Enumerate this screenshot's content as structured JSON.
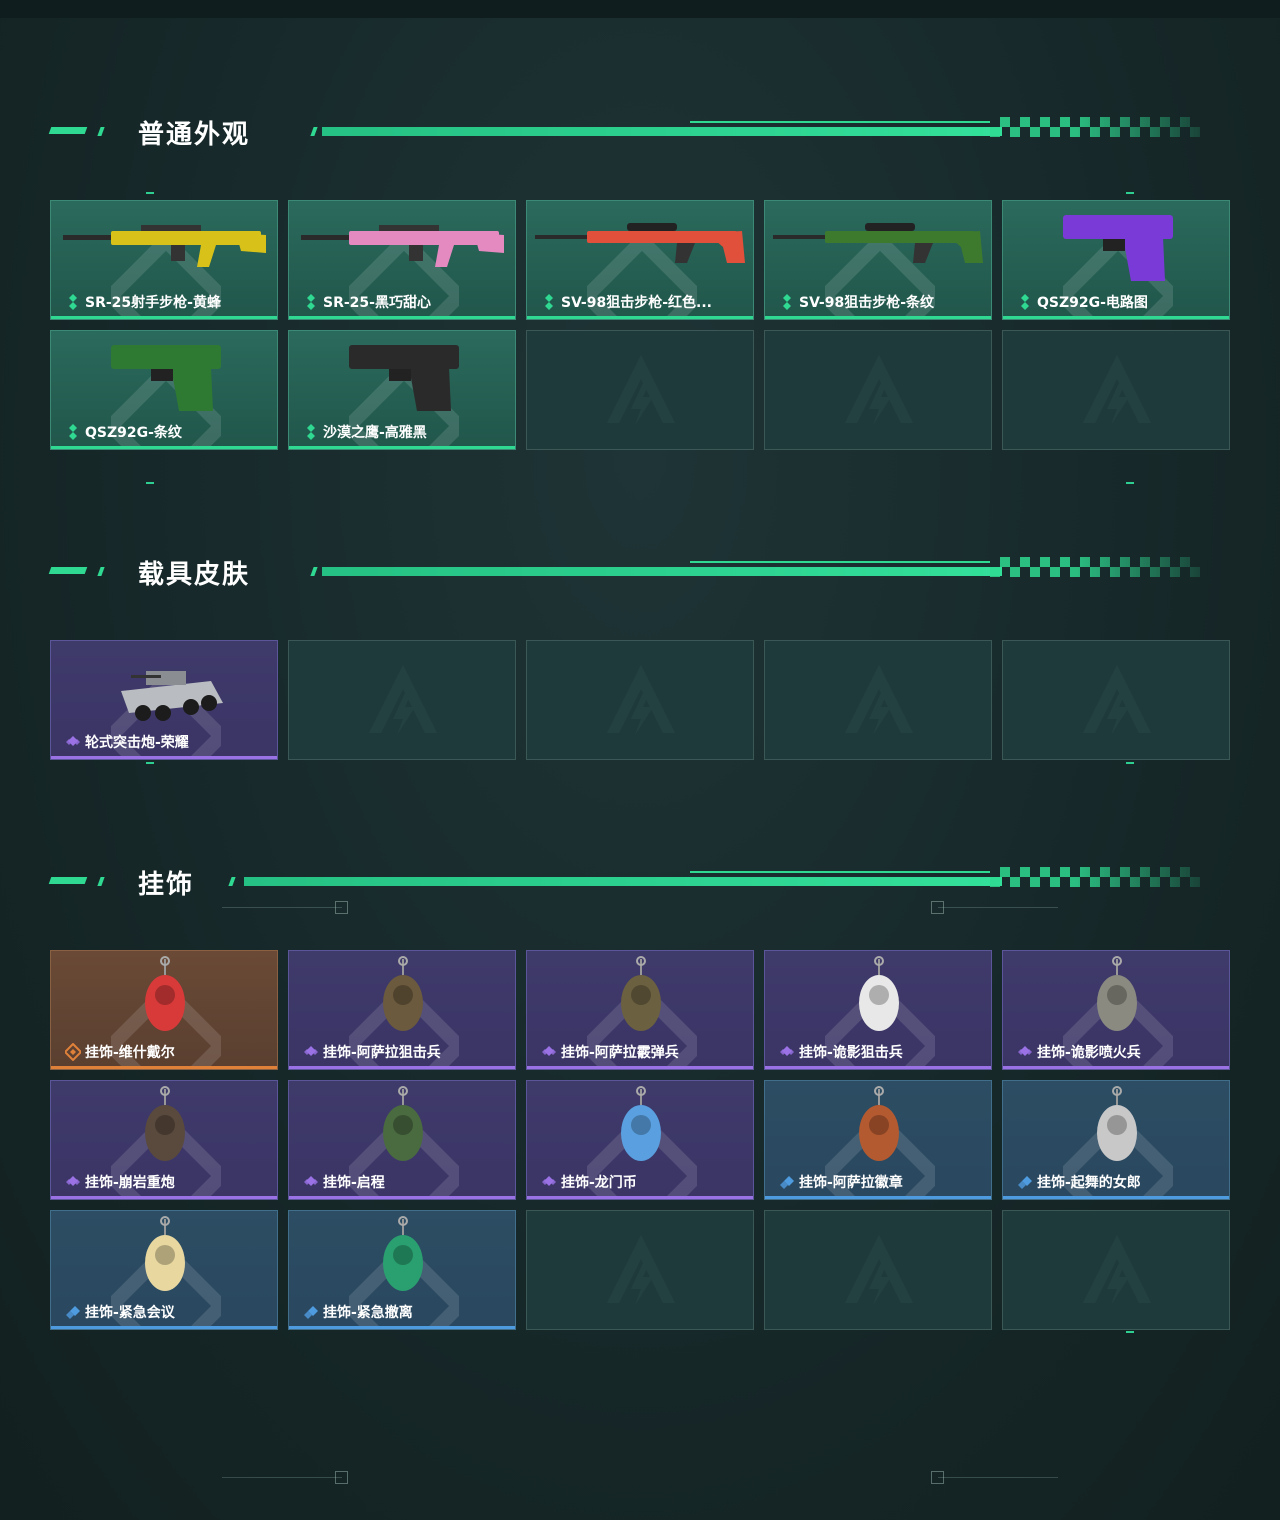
{
  "sections": [
    {
      "title": "普通外观",
      "items": [
        {
          "label": "SR-25射手步枪-黄蜂",
          "rarity": "green",
          "icon": "rifle-icon"
        },
        {
          "label": "SR-25-黑巧甜心",
          "rarity": "green",
          "icon": "rifle-icon"
        },
        {
          "label": "SV-98狙击步枪-红色...",
          "rarity": "green",
          "icon": "sniper-rifle-icon"
        },
        {
          "label": "SV-98狙击步枪-条纹",
          "rarity": "green",
          "icon": "sniper-rifle-icon"
        },
        {
          "label": "QSZ92G-电路图",
          "rarity": "green",
          "icon": "pistol-icon"
        },
        {
          "label": "QSZ92G-条纹",
          "rarity": "green",
          "icon": "pistol-icon"
        },
        {
          "label": "沙漠之鹰-高雅黑",
          "rarity": "green",
          "icon": "pistol-icon"
        }
      ],
      "empty_slots": 3
    },
    {
      "title": "载具皮肤",
      "items": [
        {
          "label": "轮式突击炮-荣耀",
          "rarity": "purple",
          "icon": "armored-vehicle-icon"
        }
      ],
      "empty_slots": 4
    },
    {
      "title": "挂饰",
      "items": [
        {
          "label": "挂饰-维什戴尔",
          "rarity": "orange",
          "icon": "charm-icon"
        },
        {
          "label": "挂饰-阿萨拉狙击兵",
          "rarity": "purple",
          "icon": "charm-icon"
        },
        {
          "label": "挂饰-阿萨拉霰弹兵",
          "rarity": "purple",
          "icon": "charm-icon"
        },
        {
          "label": "挂饰-诡影狙击兵",
          "rarity": "purple",
          "icon": "charm-icon"
        },
        {
          "label": "挂饰-诡影喷火兵",
          "rarity": "purple",
          "icon": "charm-icon"
        },
        {
          "label": "挂饰-崩岩重炮",
          "rarity": "purple",
          "icon": "charm-icon"
        },
        {
          "label": "挂饰-启程",
          "rarity": "purple",
          "icon": "charm-icon"
        },
        {
          "label": "挂饰-龙门币",
          "rarity": "purple",
          "icon": "charm-icon"
        },
        {
          "label": "挂饰-阿萨拉徽章",
          "rarity": "blue",
          "icon": "charm-icon"
        },
        {
          "label": "挂饰-起舞的女郎",
          "rarity": "blue",
          "icon": "charm-icon"
        },
        {
          "label": "挂饰-紧急会议",
          "rarity": "blue",
          "icon": "charm-icon"
        },
        {
          "label": "挂饰-紧急撤离",
          "rarity": "blue",
          "icon": "charm-icon"
        }
      ],
      "empty_slots": 3
    }
  ],
  "colors": {
    "accent": "#2fd991",
    "green": "#2fd991",
    "purple": "#9a72e6",
    "orange": "#e0813a",
    "blue": "#4f9be0"
  }
}
